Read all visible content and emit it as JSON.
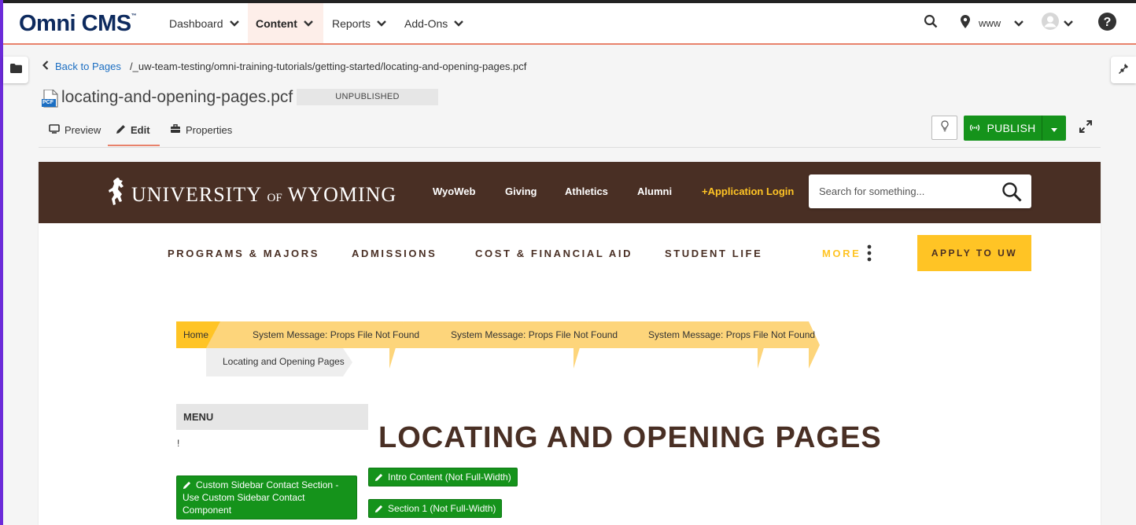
{
  "cms": {
    "logo": "Omni CMS",
    "logo_tm": "™",
    "nav": [
      {
        "label": "Dashboard"
      },
      {
        "label": "Content"
      },
      {
        "label": "Reports"
      },
      {
        "label": "Add-Ons"
      }
    ],
    "site_selector": "www"
  },
  "breadcrumb_bar": {
    "back_label": "Back to Pages",
    "path": "/_uw-team-testing/omni-training-tutorials/getting-started/locating-and-opening-pages.pcf"
  },
  "file": {
    "icon_label": "PCF",
    "name": "locating-and-opening-pages.pcf",
    "status": "UNPUBLISHED"
  },
  "view_tabs": [
    {
      "label": "Preview"
    },
    {
      "label": "Edit"
    },
    {
      "label": "Properties"
    }
  ],
  "actions": {
    "publish_label": "PUBLISH"
  },
  "site": {
    "wordmark_a": "UNIVERSITY",
    "wordmark_of": "OF",
    "wordmark_b": "WYOMING",
    "header_links": [
      "WyoWeb",
      "Giving",
      "Athletics",
      "Alumni"
    ],
    "login_link": "+Application Login",
    "search_placeholder": "Search for something...",
    "menu": [
      "PROGRAMS & MAJORS",
      "ADMISSIONS",
      "COST & FINANCIAL AID",
      "STUDENT LIFE"
    ],
    "more_label": "MORE",
    "apply_label": "APPLY TO UW",
    "crumbs": {
      "home": "Home",
      "msg1": "System Message: Props File Not Found",
      "msg2": "System Message: Props File Not Found",
      "msg3": "System Message: Props File Not Found",
      "current": "Locating and Opening Pages"
    },
    "sidebar_menu_title": "MENU",
    "sidebar_bang": "!",
    "page_heading": "LOCATING AND OPENING PAGES",
    "edit_regions": {
      "sidebar_contact_line1": "Custom Sidebar Contact Section -",
      "sidebar_contact_line2": "Use Custom Sidebar Contact Component",
      "intro": "Intro Content (Not Full-Width)",
      "section1": "Section 1 (Not Full-Width)"
    }
  },
  "colors": {
    "omni_navy": "#0d2a5e",
    "accent_orange": "#e8826b",
    "publish_green": "#15931b",
    "uw_brown": "#492f24",
    "uw_gold": "#ffc425"
  }
}
